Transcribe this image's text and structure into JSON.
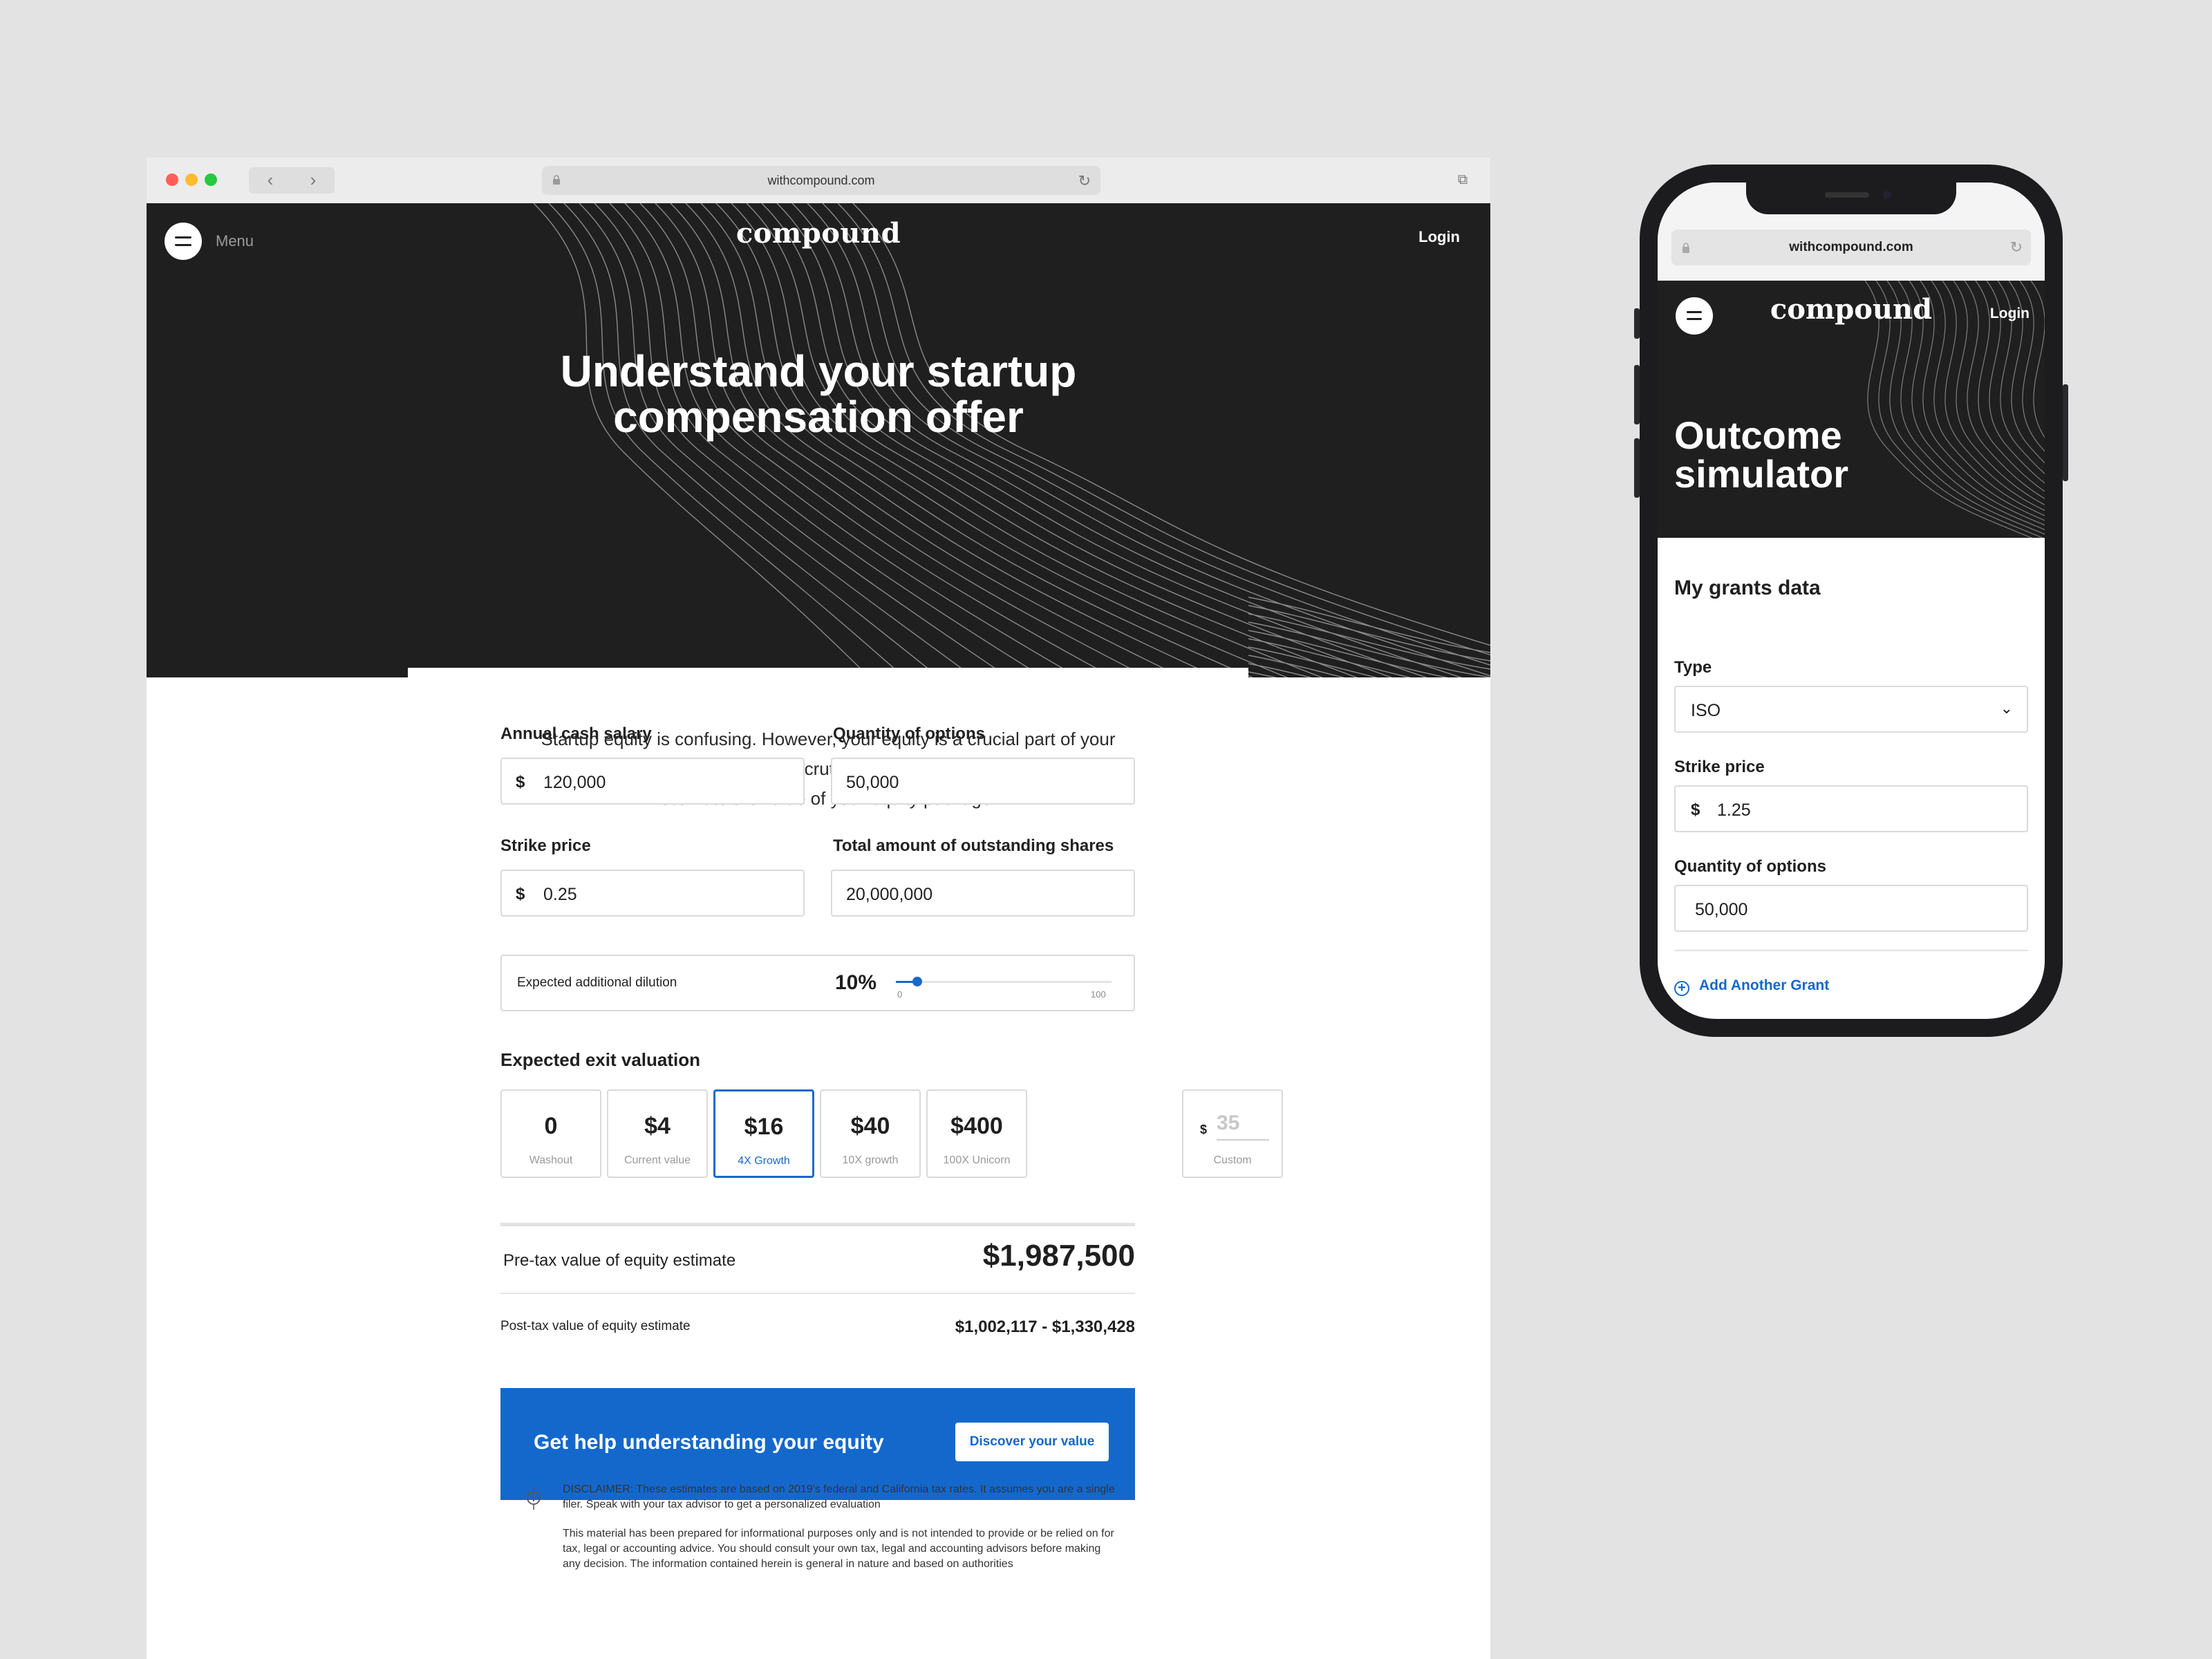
{
  "desktop": {
    "address_bar": {
      "url": "withcompound.com"
    },
    "header": {
      "menu_label": "Menu",
      "logo": "compound",
      "login": "Login"
    },
    "hero": {
      "title_line1": "Understand your startup",
      "title_line2": "compensation offer",
      "intro": "Startup equity is confusing. However, your equity is a crucial part of your compensation and is worth being scrutinized as such. This tool will help you estimate the value of your equity package."
    },
    "form": {
      "salary": {
        "label": "Annual cash salary",
        "currency": "$",
        "value": "120,000"
      },
      "options": {
        "label": "Quantity of options",
        "value": "50,000"
      },
      "strike": {
        "label": "Strike price",
        "currency": "$",
        "value": "0.25"
      },
      "shares": {
        "label": "Total amount of outstanding shares",
        "value": "20,000,000"
      },
      "dilution": {
        "label": "Expected additional dilution",
        "value_text": "10%",
        "value": 10,
        "min": "0",
        "max": "100"
      }
    },
    "exit": {
      "title": "Expected exit valuation",
      "options": [
        {
          "value": "0",
          "sub": "Washout"
        },
        {
          "value": "$4",
          "sub": "Current value"
        },
        {
          "value": "$16",
          "sub": "4X Growth"
        },
        {
          "value": "$40",
          "sub": "10X growth"
        },
        {
          "value": "$400",
          "sub": "100X Unicorn"
        }
      ],
      "selected_index": 2,
      "custom": {
        "currency": "$",
        "placeholder": "35",
        "sub": "Custom"
      }
    },
    "results": {
      "pretax_label": "Pre-tax value of equity estimate",
      "pretax_value": "$1,987,500",
      "posttax_label": "Post-tax value of equity estimate",
      "posttax_value": "$1,002,117 - $1,330,428"
    },
    "cta": {
      "text": "Get help understanding your equity",
      "button": "Discover your value"
    },
    "disclaimer": {
      "p1": "DISCLAIMER: These estimates are based on 2019's federal and California tax rates. It assumes you are a single filer. Speak with your tax advisor to get a personalized evaluation",
      "p2": "This material has been prepared for informational purposes only and is not intended to provide or be relied on for tax, legal or accounting advice. You should consult your own tax, legal and accounting advisors before making any decision. The information contained herein is general in nature and based on authorities"
    }
  },
  "mobile": {
    "address_bar": {
      "url": "withcompound.com"
    },
    "header": {
      "logo": "compound",
      "login": "Login"
    },
    "title_line1": "Outcome",
    "title_line2": "simulator",
    "section_title": "My grants data",
    "type": {
      "label": "Type",
      "value": "ISO"
    },
    "strike": {
      "label": "Strike price",
      "currency": "$",
      "value": "1.25"
    },
    "options": {
      "label": "Quantity of options",
      "value": "50,000"
    },
    "add_grant": "Add Another Grant"
  },
  "colors": {
    "accent": "#1468cc",
    "hero_bg": "#1f1f1f",
    "page_bg": "#e3e3e3"
  },
  "icons": [
    "menu-icon",
    "lock-icon",
    "reload-icon",
    "back-icon",
    "forward-icon",
    "tabs-icon",
    "info-icon",
    "chevron-down-icon",
    "plus-circle-icon"
  ]
}
